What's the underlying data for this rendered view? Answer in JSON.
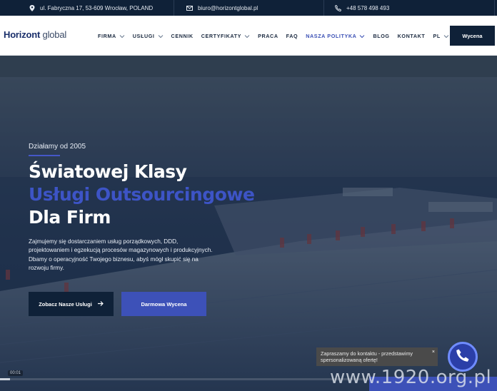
{
  "topbar": {
    "address": "ul. Fabryczna 17, 53-609 Wrocław, POLAND",
    "email": "biuro@horizontglobal.pl",
    "phone": "+48 578 498 493"
  },
  "nav": {
    "logo_bold": "Horizont",
    "logo_light": " global",
    "items": [
      {
        "label": "FIRMA",
        "dropdown": true
      },
      {
        "label": "USŁUGI",
        "dropdown": true
      },
      {
        "label": "CENNIK",
        "dropdown": false
      },
      {
        "label": "CERTYFIKATY",
        "dropdown": true
      },
      {
        "label": "PRACA",
        "dropdown": false
      },
      {
        "label": "FAQ",
        "dropdown": false
      },
      {
        "label": "NASZA POLITYKA",
        "dropdown": true,
        "active": true
      },
      {
        "label": "BLOG",
        "dropdown": false
      },
      {
        "label": "KONTAKT",
        "dropdown": false
      },
      {
        "label": "PL",
        "dropdown": true
      }
    ],
    "cta_label": "Wycena"
  },
  "hero": {
    "since": "Działamy od 2005",
    "title_line1": "Światowej Klasy",
    "title_line2": "Usługi Outsourcingowe",
    "title_line3": "Dla Firm",
    "lead": "Zajmujemy się dostarczaniem usług porządkowych, DDD, projektowaniem i egzekucją procesów magazynowych i produkcyjnych. Dbamy o operacyjność Twojego biznesu, abyś mógł skupić się na rozwoju firmy.",
    "button_primary": "Zobacz Nasze Usługi",
    "button_secondary": "Darmowa Wycena"
  },
  "video": {
    "time": "00:01",
    "progress": 0.02
  },
  "chat": {
    "message": "Zapraszamy do kontaktu - przedstawimy spersonalizowaną ofertę!",
    "close_label": "×"
  },
  "watermark": "www.1920.org.pl",
  "colors": {
    "navy": "#0f2138",
    "accent": "#3d51b8",
    "white": "#ffffff"
  },
  "icons": {
    "address": "location-pin-icon",
    "email": "envelope-icon",
    "phone": "phone-icon"
  }
}
